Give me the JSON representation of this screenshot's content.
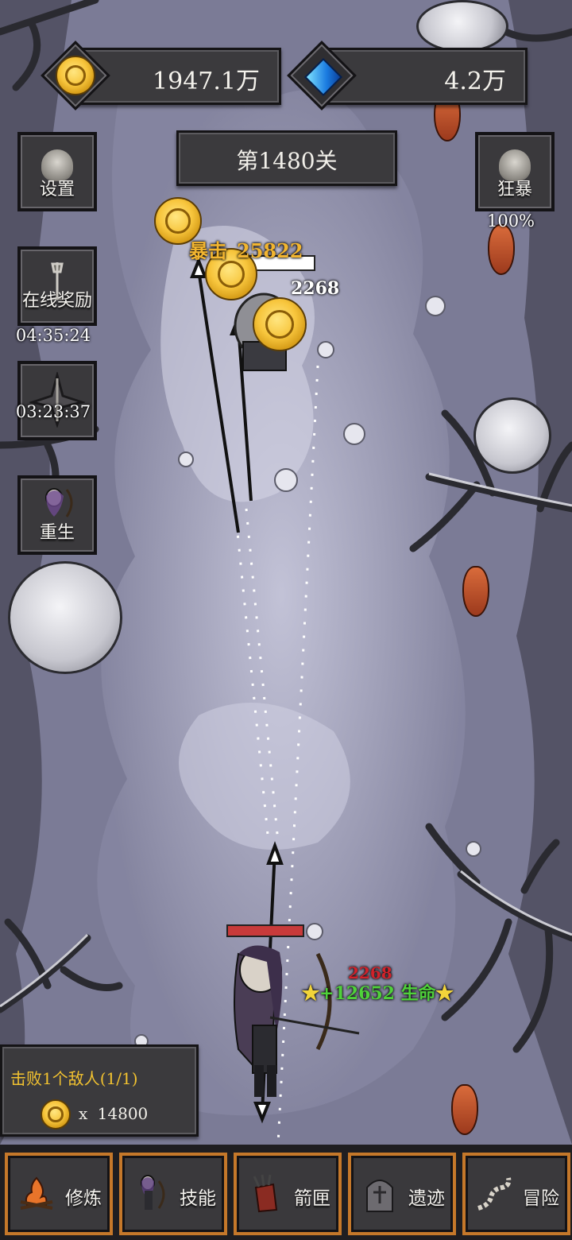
{
  "currency": {
    "gold": "1947.1万",
    "gems": "4.2万"
  },
  "stage": "第1480关",
  "left_menu": {
    "settings": "设置",
    "online_reward": "在线奖励",
    "online_timer": "04:35:24",
    "event_timer": "03:23:37",
    "rebirth": "重生"
  },
  "right_menu": {
    "berserk": "狂暴",
    "berserk_percent": "100%"
  },
  "combat": {
    "crit_text": "暴击",
    "crit_value": "25822",
    "enemy_damage": "2268",
    "player_damage": "2268",
    "heal_text": "+12652 生命"
  },
  "quest": {
    "title": "击败1个敌人(1/1)",
    "reward_multiplier": "x",
    "reward_amount": "14800"
  },
  "tabs": [
    {
      "label": "修炼",
      "icon": "campfire-icon"
    },
    {
      "label": "技能",
      "icon": "archer-icon"
    },
    {
      "label": "箭匣",
      "icon": "quiver-icon"
    },
    {
      "label": "遗迹",
      "icon": "tombstone-icon"
    },
    {
      "label": "冒险",
      "icon": "path-icon"
    }
  ],
  "colors": {
    "panel": "#3b3a3d",
    "tab_border": "#c5782a",
    "quest_text": "#f2c230",
    "heal": "#4fd13a",
    "damage": "#d1222a"
  }
}
